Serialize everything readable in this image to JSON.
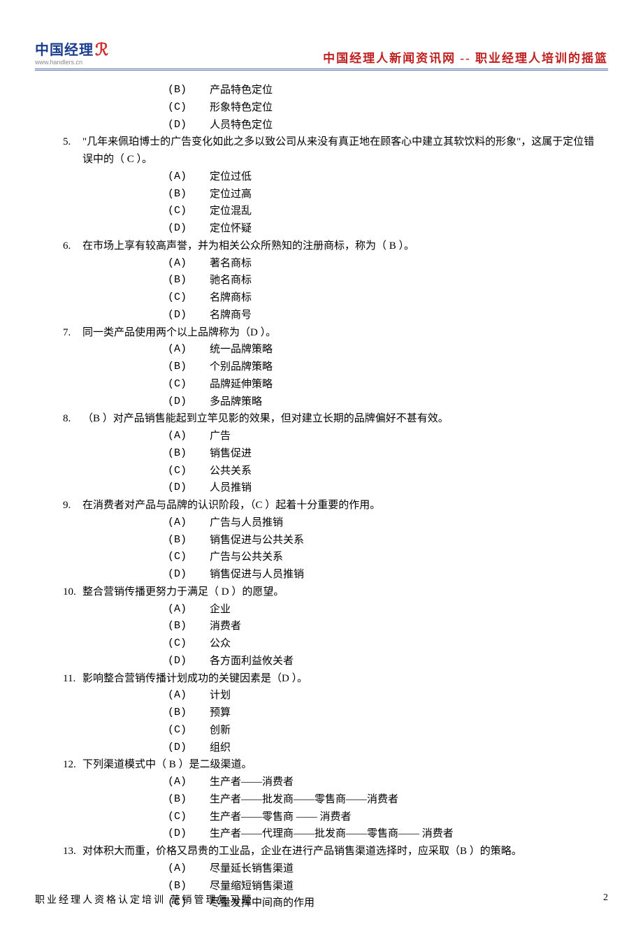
{
  "header": {
    "logo_main": "中国经理",
    "logo_bracket": "ℛ",
    "logo_sub": "www.handlers.cn",
    "right": "中国经理人新闻资讯网 -- 职业经理人培训的摇篮"
  },
  "pre_options": [
    {
      "label": "(B)",
      "text": "产品特色定位"
    },
    {
      "label": "(C)",
      "text": "形象特色定位"
    },
    {
      "label": "(D)",
      "text": "人员特色定位"
    }
  ],
  "questions": [
    {
      "num": "5.",
      "text": "\"几年来佩珀博士的广告变化如此之多以致公司从来没有真正地在顾客心中建立其软饮料的形象\"，这属于定位错误中的（ C  ）。",
      "options": [
        {
          "label": "(A)",
          "text": "定位过低"
        },
        {
          "label": "(B)",
          "text": "定位过高"
        },
        {
          "label": "(C)",
          "text": "定位混乱"
        },
        {
          "label": "(D)",
          "text": "定位怀疑"
        }
      ]
    },
    {
      "num": "6.",
      "text": "在市场上享有较高声誉，并为相关公众所熟知的注册商标，称为（ B  ）。",
      "options": [
        {
          "label": "(A)",
          "text": "著名商标"
        },
        {
          "label": "(B)",
          "text": "驰名商标"
        },
        {
          "label": "(C)",
          "text": "名牌商标"
        },
        {
          "label": "(D)",
          "text": "名牌商号"
        }
      ]
    },
    {
      "num": "7.",
      "text": "同一类产品使用两个以上品牌称为（D   ）。",
      "options": [
        {
          "label": "(A)",
          "text": "统一品牌策略"
        },
        {
          "label": "(B)",
          "text": "个别品牌策略"
        },
        {
          "label": "(C)",
          "text": "品牌延伸策略"
        },
        {
          "label": "(D)",
          "text": "多品牌策略"
        }
      ]
    },
    {
      "num": "8.",
      "text": "（B  ）对产品销售能起到立竿见影的效果，但对建立长期的品牌偏好不甚有效。",
      "options": [
        {
          "label": "(A)",
          "text": "广告"
        },
        {
          "label": "(B)",
          "text": "销售促进"
        },
        {
          "label": "(C)",
          "text": "公共关系"
        },
        {
          "label": "(D)",
          "text": "人员推销"
        }
      ]
    },
    {
      "num": "9.",
      "text": "在消费者对产品与品牌的认识阶段，（C   ）起着十分重要的作用。",
      "options": [
        {
          "label": "(A)",
          "text": "广告与人员推销"
        },
        {
          "label": "(B)",
          "text": "销售促进与公共关系"
        },
        {
          "label": "(C)",
          "text": "广告与公共关系"
        },
        {
          "label": "(D)",
          "text": "销售促进与人员推销"
        }
      ]
    },
    {
      "num": "10.",
      "text": "整合营销传播更努力于满足（ D  ）的愿望。",
      "options": [
        {
          "label": "(A)",
          "text": "企业"
        },
        {
          "label": "(B)",
          "text": "消费者"
        },
        {
          "label": "(C)",
          "text": "公众"
        },
        {
          "label": "(D)",
          "text": "各方面利益攸关者"
        }
      ]
    },
    {
      "num": "11.",
      "text": "影响整合营销传播计划成功的关键因素是（D   ）。",
      "options": [
        {
          "label": "(A)",
          "text": "计划"
        },
        {
          "label": "(B)",
          "text": "预算"
        },
        {
          "label": "(C)",
          "text": "创新"
        },
        {
          "label": "(D)",
          "text": "组织"
        }
      ]
    },
    {
      "num": "12.",
      "text": "下列渠道模式中（ B  ）是二级渠道。",
      "options": [
        {
          "label": "(A)",
          "text": "生产者——消费者"
        },
        {
          "label": "(B)",
          "text": "生产者——批发商——零售商——消费者"
        },
        {
          "label": "(C)",
          "text": "生产者——零售商 —— 消费者"
        },
        {
          "label": "(D)",
          "text": "生产者——代理商——批发商——零售商—— 消费者"
        }
      ]
    },
    {
      "num": "13.",
      "text": "对体积大而重，价格又昂贵的工业品，企业在进行产品销售渠道选择时，应采取（B  ）的策略。",
      "options": [
        {
          "label": "(A)",
          "text": "尽量延长销售渠道"
        },
        {
          "label": "(B)",
          "text": "尽量缩短销售渠道"
        },
        {
          "label": "(C)",
          "text": "尽量发挥中间商的作用"
        }
      ]
    }
  ],
  "footer": {
    "left": "职业经理人资格认定培训   营销管理复习题",
    "page": "2"
  }
}
